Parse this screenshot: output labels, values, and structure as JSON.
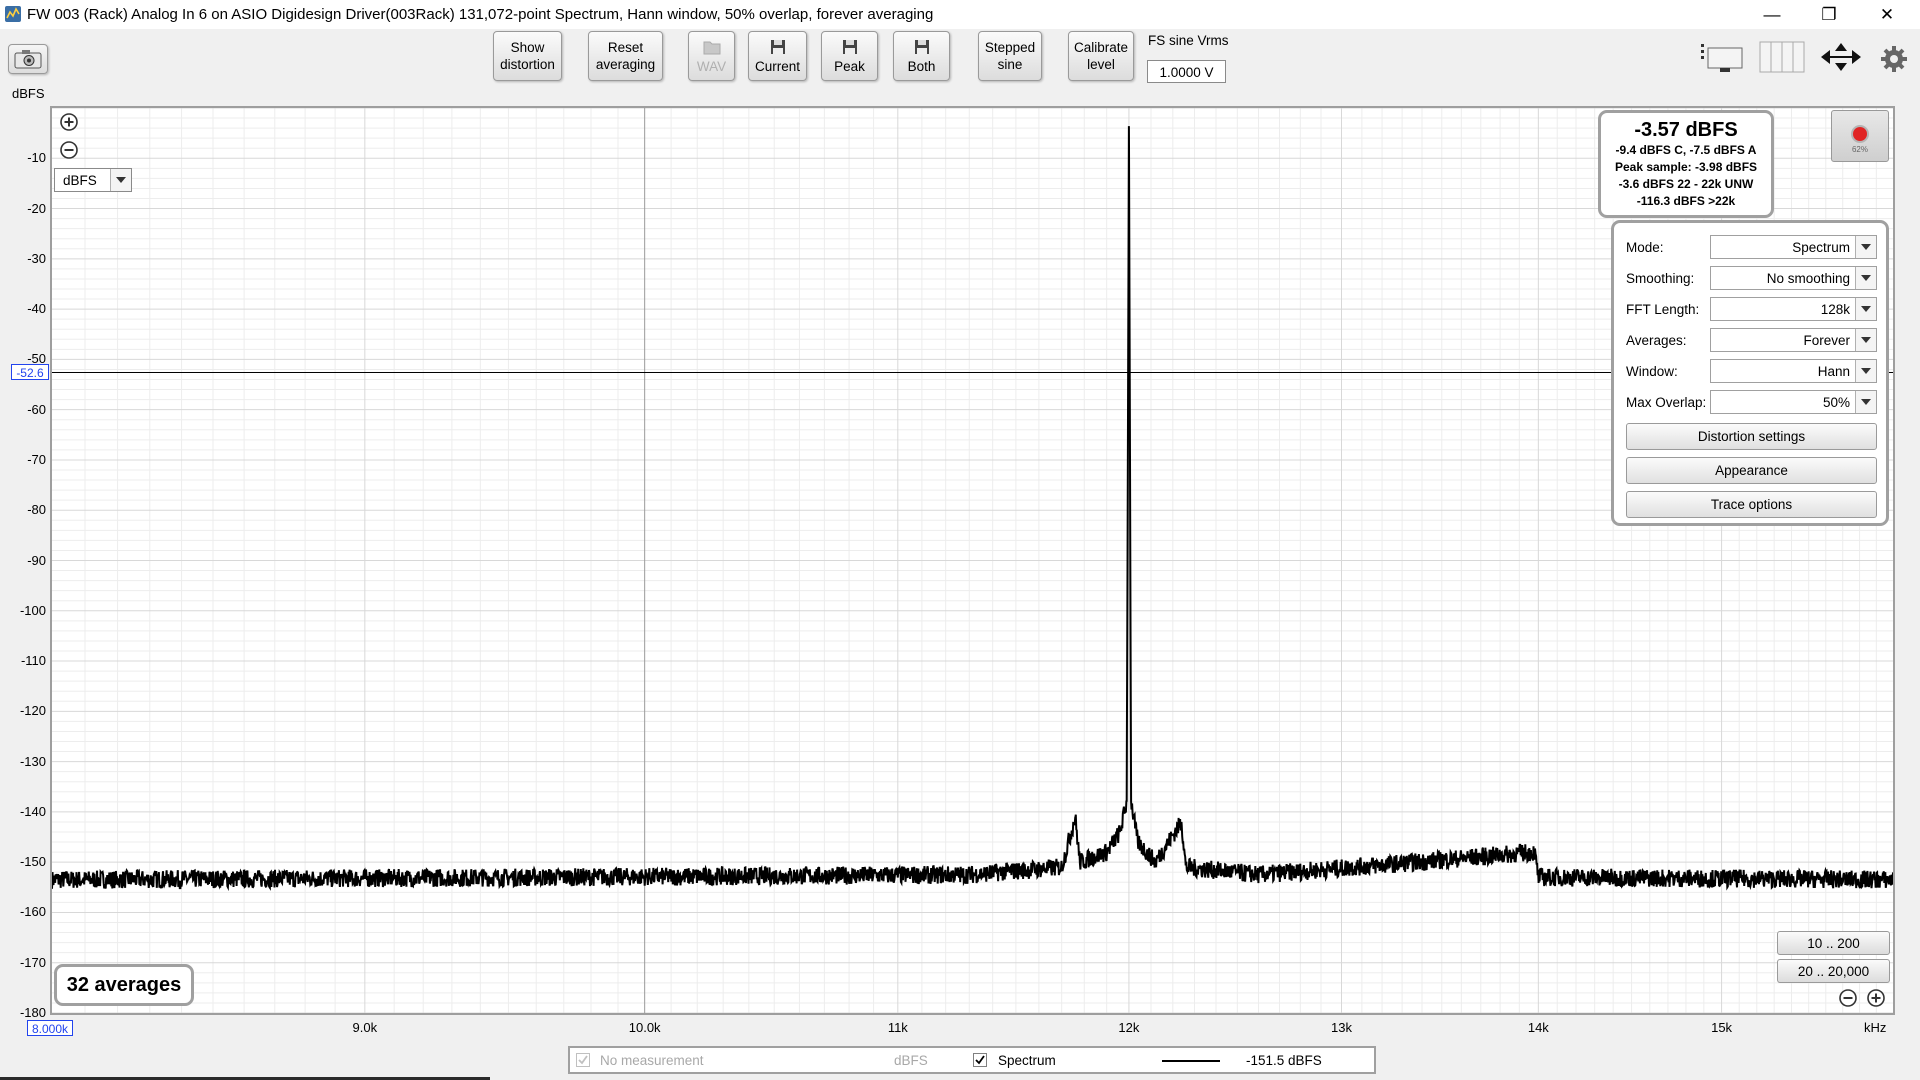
{
  "window": {
    "title": "FW 003 (Rack) Analog In 6 on ASIO Digidesign Driver(003Rack) 131,072-point Spectrum, Hann window, 50% overlap, forever averaging",
    "minimize_glyph": "—",
    "restore_glyph": "❐",
    "close_glyph": "✕"
  },
  "toolbar": {
    "buttons": [
      {
        "id": "show-distortion",
        "line1": "Show",
        "line2": "distortion"
      },
      {
        "id": "reset-averaging",
        "line1": "Reset",
        "line2": "averaging"
      },
      {
        "id": "wav",
        "label": "WAV",
        "disabled": true
      },
      {
        "id": "current",
        "label": "Current"
      },
      {
        "id": "peak",
        "label": "Peak"
      },
      {
        "id": "both",
        "label": "Both"
      },
      {
        "id": "stepped-sine",
        "line1": "Stepped",
        "line2": "sine"
      },
      {
        "id": "calibrate-level",
        "line1": "Calibrate",
        "line2": "level"
      }
    ],
    "fs_label": "FS sine Vrms",
    "fs_value": "1.0000 V"
  },
  "graph": {
    "unit_select": "dBFS",
    "level": {
      "main": "-3.57 dBFS",
      "lines": [
        "-9.4 dBFS C, -7.5 dBFS A",
        "Peak sample: -3.98 dBFS",
        "-3.6 dBFS 22 - 22k UNW",
        "-116.3 dBFS >22k"
      ]
    },
    "rec_pct": "62%",
    "settings": [
      {
        "label": "Mode:",
        "value": "Spectrum"
      },
      {
        "label": "Smoothing:",
        "value": "No  smoothing"
      },
      {
        "label": "FFT Length:",
        "value": "128k"
      },
      {
        "label": "Averages:",
        "value": "Forever"
      },
      {
        "label": "Window:",
        "value": "Hann"
      },
      {
        "label": "Max Overlap:",
        "value": "50%"
      }
    ],
    "settings_buttons": [
      "Distortion settings",
      "Appearance",
      "Trace options"
    ],
    "averages": "32 averages",
    "range_buttons": [
      "10 .. 200",
      "20 .. 20,000"
    ],
    "cursor_y": "-52.6",
    "cursor_x": "8.000k"
  },
  "legend": {
    "no_measurement": "No measurement",
    "no_measurement_unit": "dBFS",
    "spectrum_label": "Spectrum",
    "spectrum_value": "-151.5 dBFS"
  },
  "colors": {
    "trace": "#000000",
    "cursor": "#2244ee",
    "grid_major": "#d8d8d8",
    "grid_minor": "#ededed"
  },
  "chart_data": {
    "type": "line",
    "title": "",
    "xlabel": "",
    "ylabel": "",
    "y_unit": "dBFS",
    "x_unit": "kHz",
    "xlim": [
      8000,
      16000
    ],
    "ylim": [
      -180,
      0
    ],
    "x_scale": "log",
    "x_ticks": [
      {
        "value": 9000,
        "label": "9.0k"
      },
      {
        "value": 10000,
        "label": "10.0k"
      },
      {
        "value": 11000,
        "label": "11k"
      },
      {
        "value": 12000,
        "label": "12k"
      },
      {
        "value": 13000,
        "label": "13k"
      },
      {
        "value": 14000,
        "label": "14k"
      },
      {
        "value": 15000,
        "label": "15k"
      }
    ],
    "y_ticks": [
      -10,
      -20,
      -30,
      -40,
      -50,
      -60,
      -70,
      -80,
      -90,
      -100,
      -110,
      -120,
      -130,
      -140,
      -150,
      -160,
      -170,
      -180
    ],
    "grid": true,
    "series": [
      {
        "name": "Spectrum",
        "noise_floor": -153.5,
        "points": [
          {
            "x": 8000,
            "y": -153.5
          },
          {
            "x": 11300,
            "y": -152.5
          },
          {
            "x": 11700,
            "y": -151
          },
          {
            "x": 11760,
            "y": -141
          },
          {
            "x": 11780,
            "y": -150
          },
          {
            "x": 11900,
            "y": -148
          },
          {
            "x": 11960,
            "y": -144
          },
          {
            "x": 11990,
            "y": -138
          },
          {
            "x": 12000,
            "y": -3.6
          },
          {
            "x": 12010,
            "y": -138
          },
          {
            "x": 12040,
            "y": -146
          },
          {
            "x": 12120,
            "y": -150
          },
          {
            "x": 12240,
            "y": -142
          },
          {
            "x": 12260,
            "y": -151
          },
          {
            "x": 12600,
            "y": -152.5
          },
          {
            "x": 13980,
            "y": -148
          },
          {
            "x": 14000,
            "y": -153
          },
          {
            "x": 16000,
            "y": -153.5
          }
        ]
      }
    ],
    "cursor": {
      "x": 8000,
      "y": -52.6
    }
  }
}
